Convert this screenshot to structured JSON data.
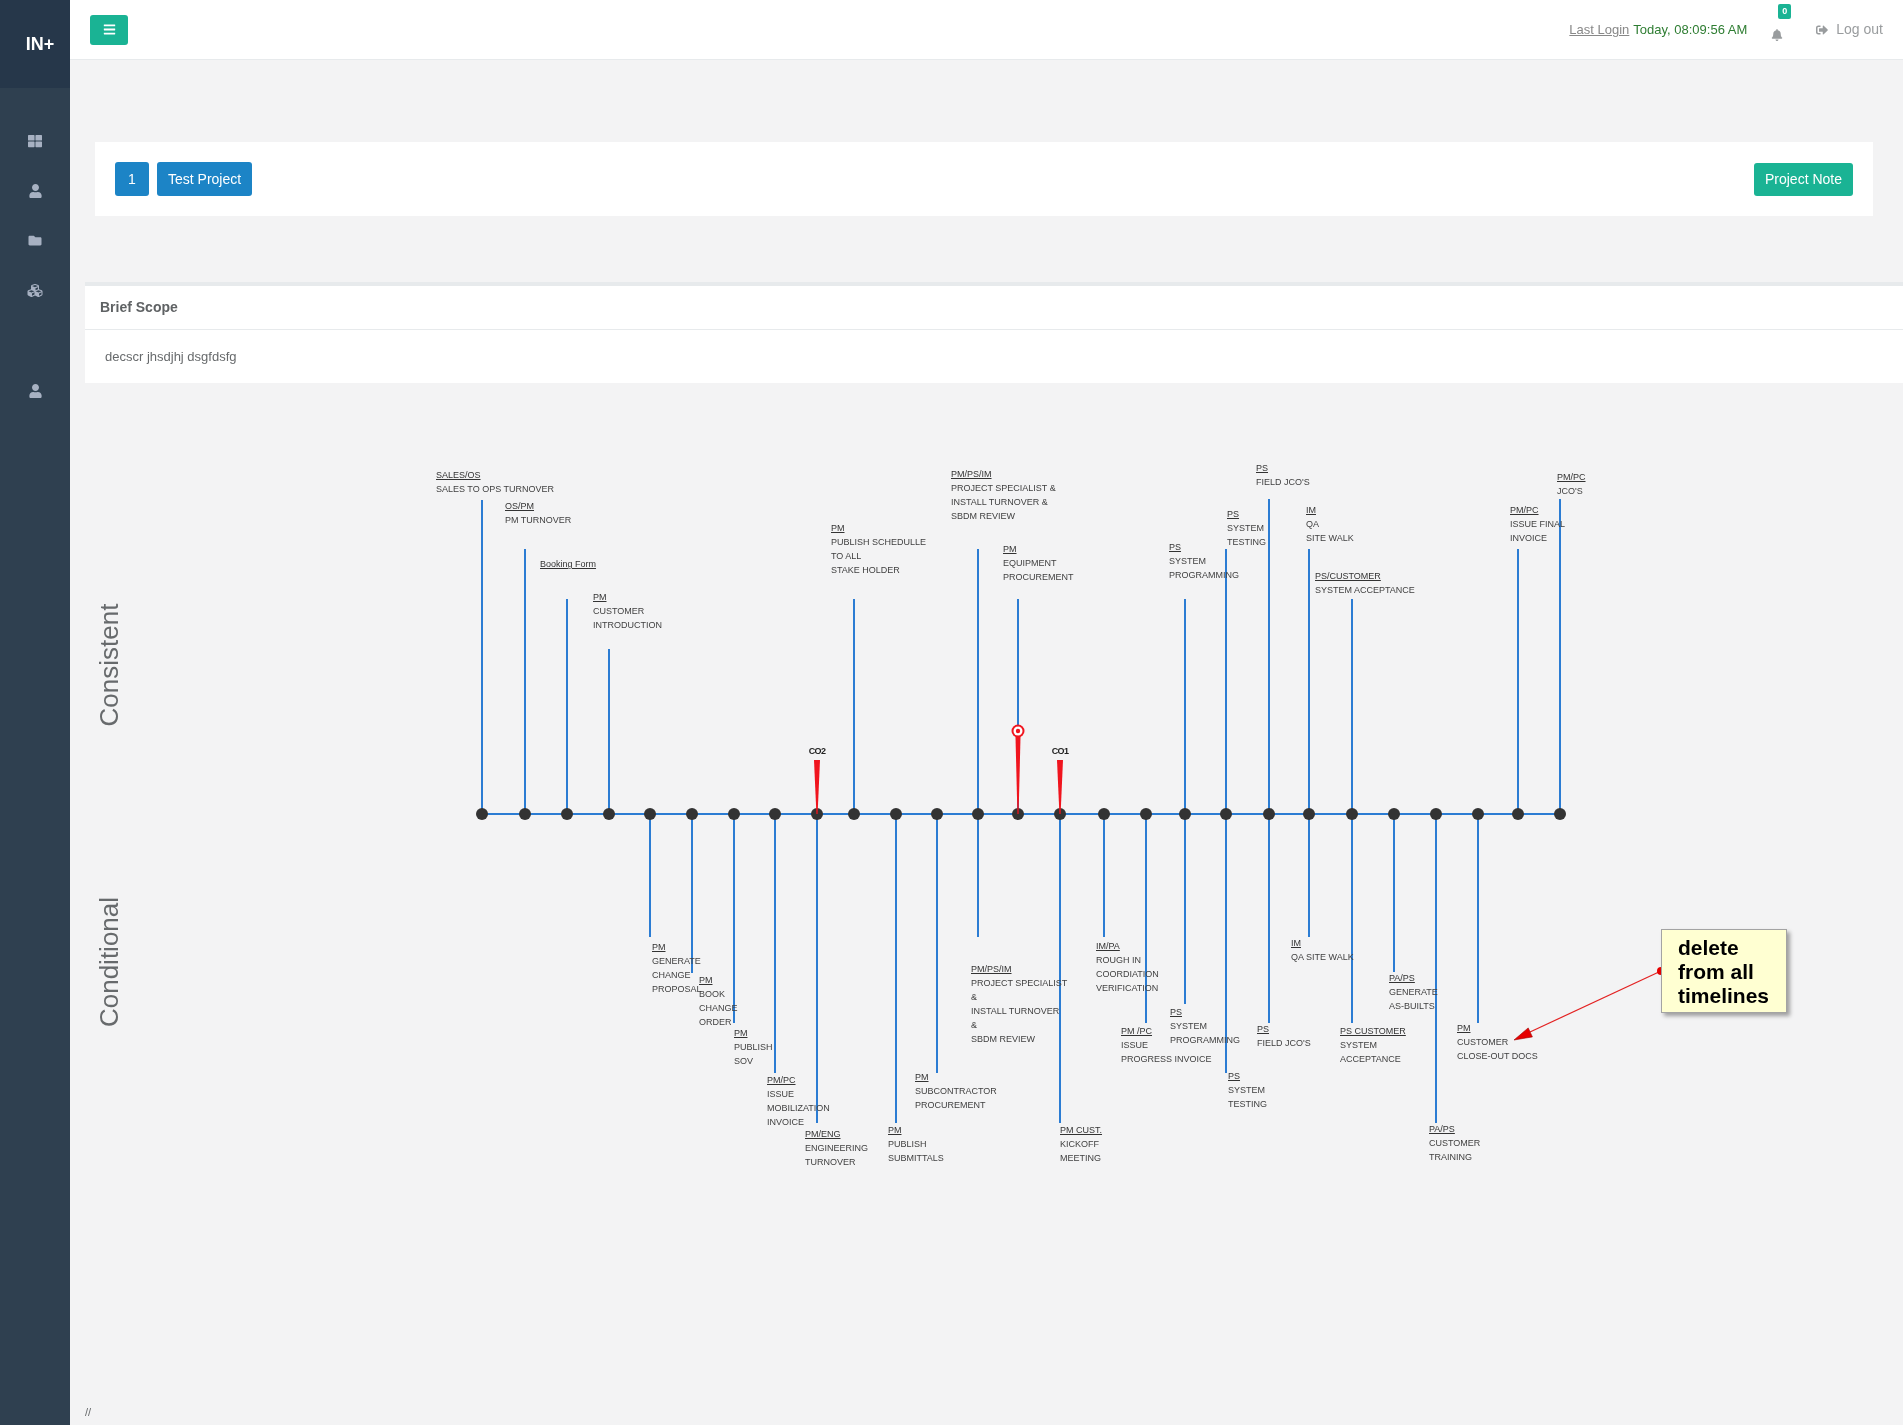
{
  "sidebar": {
    "logo": "IN+"
  },
  "header": {
    "last_login_label": "Last Login",
    "last_login_value": "Today, 08:09:56 AM",
    "notifications": "0",
    "logout": "Log out"
  },
  "project_bar": {
    "number": "1",
    "name": "Test Project",
    "note_button": "Project Note"
  },
  "brief_scope": {
    "title": "Brief Scope",
    "text": "decscr jhsdjhj dsgfdsfg"
  },
  "timeline": {
    "sections": [
      "Consistent",
      "Conditional"
    ],
    "milestones": [
      {
        "above": {
          "role": "SALES/OS",
          "lines": [
            "SALES TO OPS TURNOVER"
          ]
        }
      },
      {
        "above": {
          "role": "OS/PM",
          "lines": [
            "PM TURNOVER"
          ]
        }
      },
      {
        "above": {
          "role": "Booking Form"
        }
      },
      {
        "above": {
          "role": "PM",
          "lines": [
            "CUSTOMER",
            "INTRODUCTION"
          ]
        }
      },
      {
        "below": {
          "role": "PM",
          "lines": [
            "GENERATE",
            "CHANGE",
            "PROPOSAL"
          ]
        }
      },
      {
        "below": {
          "role": "PM",
          "lines": [
            "BOOK",
            "CHANGE",
            "ORDER"
          ]
        }
      },
      {
        "below": {
          "role": "PM",
          "lines": [
            "PUBLISH",
            "SOV"
          ]
        }
      },
      {
        "below": {
          "role": "PM/PC",
          "lines": [
            "ISSUE",
            "MOBILIZATION",
            "INVOICE"
          ]
        }
      },
      {
        "marker": {
          "kind": "flag",
          "label": "CO2"
        },
        "below": {
          "role": "PM/ENG",
          "lines": [
            "ENGINEERING",
            "TURNOVER"
          ]
        }
      },
      {
        "above": {
          "role": "PM",
          "lines": [
            "PUBLISH SCHEDULLE",
            "TO ALL",
            "STAKE HOLDER"
          ]
        }
      },
      {
        "below": {
          "role": "PM",
          "lines": [
            "PUBLISH",
            "SUBMITTALS"
          ]
        }
      },
      {
        "below": {
          "role": "PM",
          "lines": [
            "SUBCONTRACTOR",
            "PROCUREMENT"
          ]
        }
      },
      {
        "above": {
          "role": "PM/PS/IM",
          "lines": [
            "PROJECT SPECIALIST &",
            "INSTALL TURNOVER &",
            "SBDM REVIEW"
          ]
        },
        "below": {
          "role": "PM/PS/IM",
          "lines": [
            "PROJECT SPECIALIST",
            "&",
            "INSTALL TURNOVER",
            "&",
            "SBDM REVIEW"
          ]
        }
      },
      {
        "marker": {
          "kind": "pin"
        },
        "above": {
          "role": "PM",
          "lines": [
            "EQUIPMENT",
            "PROCUREMENT"
          ]
        }
      },
      {
        "marker": {
          "kind": "flag",
          "label": "CO1"
        },
        "below": {
          "role": "PM CUST.",
          "lines": [
            "KICKOFF",
            "MEETING"
          ]
        }
      },
      {
        "below": {
          "role": "IM/PA",
          "lines": [
            "ROUGH IN",
            "COORDIATION",
            "VERIFICATION"
          ]
        }
      },
      {
        "below": {
          "role": "PM /PC",
          "lines": [
            "ISSUE",
            "PROGRESS INVOICE"
          ]
        }
      },
      {
        "above": {
          "role": "PS",
          "lines": [
            "SYSTEM",
            "PROGRAMMING"
          ]
        },
        "below": {
          "role": "PS",
          "lines": [
            "SYSTEM",
            "PROGRAMMING"
          ]
        }
      },
      {
        "above": {
          "role": "PS",
          "lines": [
            "SYSTEM",
            "TESTING"
          ]
        },
        "below": {
          "role": "PS",
          "lines": [
            "SYSTEM",
            "TESTING"
          ]
        }
      },
      {
        "above": {
          "role": "PS",
          "lines": [
            "FIELD JCO'S"
          ]
        },
        "below": {
          "role": "PS",
          "lines": [
            "FIELD JCO'S"
          ]
        }
      },
      {
        "above": {
          "role": "IM",
          "lines": [
            "QA",
            "SITE WALK"
          ]
        },
        "below": {
          "role": "IM",
          "lines": [
            "QA SITE WALK"
          ]
        }
      },
      {
        "above": {
          "role": "PS/CUSTOMER",
          "lines": [
            "SYSTEM ACCEPTANCE"
          ]
        },
        "below": {
          "role": "PS CUSTOMER",
          "lines": [
            "SYSTEM",
            "ACCEPTANCE"
          ]
        }
      },
      {
        "below": {
          "role": "PA/PS",
          "lines": [
            "GENERATE",
            "AS-BUILTS"
          ]
        }
      },
      {
        "below": {
          "role": "PA/PS",
          "lines": [
            "CUSTOMER",
            "TRAINING"
          ]
        }
      },
      {
        "below": {
          "role": "PM",
          "lines": [
            "CUSTOMER",
            "CLOSE-OUT DOCS"
          ]
        }
      },
      {
        "above": {
          "role": "PM/PC",
          "lines": [
            "ISSUE FINAL",
            "INVOICE"
          ]
        }
      },
      {
        "above": {
          "role": "PM/PC",
          "lines": [
            "JCO'S"
          ]
        }
      }
    ]
  },
  "annotation": {
    "text": "delete from all timelines"
  },
  "footer": "//"
}
